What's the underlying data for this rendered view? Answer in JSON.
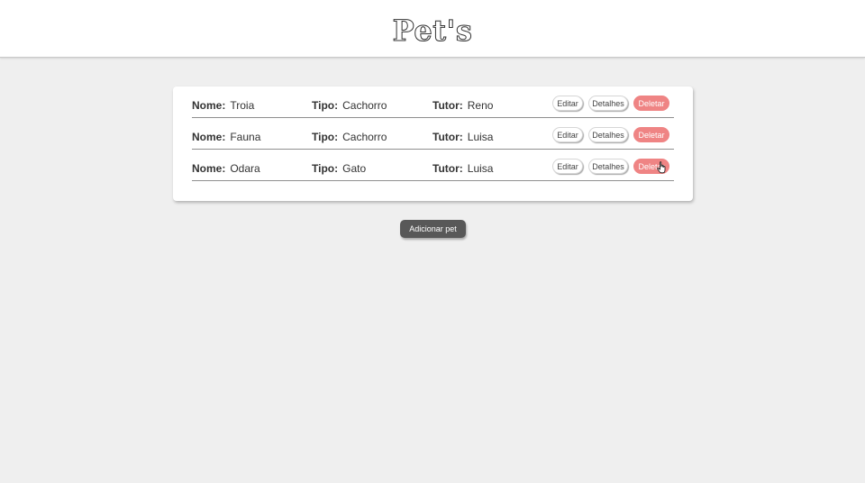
{
  "header": {
    "title": "Pet's"
  },
  "pets": [
    {
      "nome_label": "Nome:",
      "nome": "Troia",
      "tipo_label": "Tipo:",
      "tipo": "Cachorro",
      "tutor_label": "Tutor:",
      "tutor": "Reno",
      "edit": "Editar",
      "details": "Detalhes",
      "delete": "Deletar"
    },
    {
      "nome_label": "Nome:",
      "nome": "Fauna",
      "tipo_label": "Tipo:",
      "tipo": "Cachorro",
      "tutor_label": "Tutor:",
      "tutor": "Luisa",
      "edit": "Editar",
      "details": "Detalhes",
      "delete": "Deletar"
    },
    {
      "nome_label": "Nome:",
      "nome": "Odara",
      "tipo_label": "Tipo:",
      "tipo": "Gato",
      "tutor_label": "Tutor:",
      "tutor": "Luisa",
      "edit": "Editar",
      "details": "Detalhes",
      "delete": "Deletar"
    }
  ],
  "add_button": "Adicionar pet",
  "colors": {
    "delete": "#ef8484",
    "add": "#585858",
    "background": "#efefef"
  },
  "cursor": "hand-pointer-icon"
}
